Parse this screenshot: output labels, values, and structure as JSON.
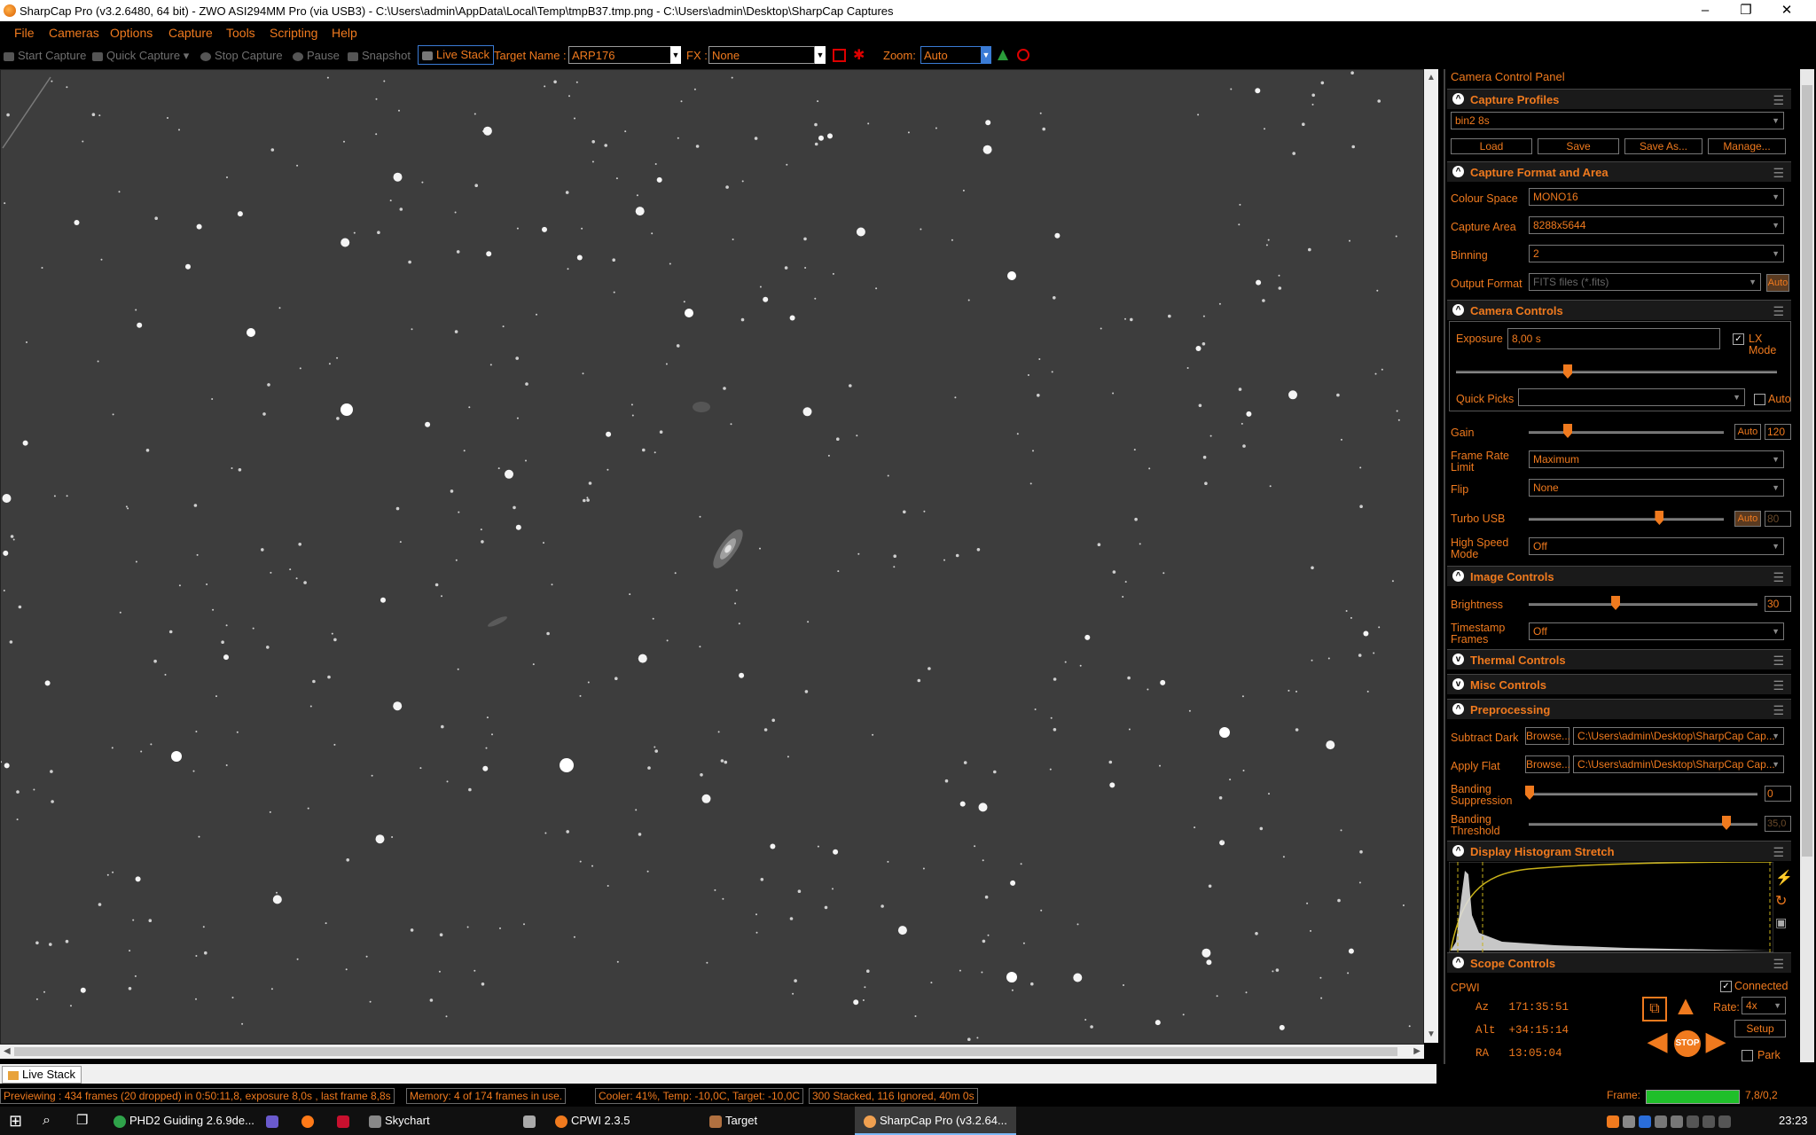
{
  "window": {
    "title": "SharpCap Pro (v3.2.6480, 64 bit) - ZWO ASI294MM Pro (via USB3) - C:\\Users\\admin\\AppData\\Local\\Temp\\tmpB37.tmp.png - C:\\Users\\admin\\Desktop\\SharpCap Captures",
    "minimize": "–",
    "restore": "❐",
    "close": "✕"
  },
  "menu": [
    "File",
    "Cameras",
    "Options",
    "Capture",
    "Tools",
    "Scripting",
    "Help"
  ],
  "toolbar": {
    "start_capture": "Start Capture",
    "quick_capture": "Quick Capture",
    "stop_capture": "Stop Capture",
    "pause": "Pause",
    "snapshot": "Snapshot",
    "live_stack": "Live Stack",
    "target_name_label": "Target Name :",
    "target_name_value": "ARP176",
    "fx_label": "FX :",
    "fx_value": "None",
    "zoom_label": "Zoom:",
    "zoom_value": "Auto"
  },
  "panel": {
    "title": "Camera Control Panel",
    "capture_profiles": {
      "header": "Capture Profiles",
      "profile": "bin2 8s",
      "load": "Load",
      "save": "Save",
      "save_as": "Save As...",
      "manage": "Manage..."
    },
    "format": {
      "header": "Capture Format and Area",
      "colour_space_label": "Colour Space",
      "colour_space": "MONO16",
      "capture_area_label": "Capture Area",
      "capture_area": "8288x5644",
      "binning_label": "Binning",
      "binning": "2",
      "output_format_label": "Output Format",
      "output_format": "FITS files (*.fits)",
      "auto": "Auto"
    },
    "camera_controls": {
      "header": "Camera Controls",
      "exposure_label": "Exposure",
      "exposure": "8,00 s",
      "lx_mode": "LX Mode",
      "quick_picks_label": "Quick Picks",
      "auto": "Auto",
      "gain_label": "Gain",
      "gain_auto": "Auto",
      "gain": "120",
      "gain_level": 0.2,
      "frame_rate_label": "Frame Rate Limit",
      "frame_rate": "Maximum",
      "flip_label": "Flip",
      "flip": "None",
      "turbo_usb_label": "Turbo USB",
      "turbo_auto": "Auto",
      "turbo_usb": "80",
      "turbo_level": 0.67,
      "high_speed_label": "High Speed Mode",
      "high_speed": "Off"
    },
    "image_controls": {
      "header": "Image Controls",
      "brightness_label": "Brightness",
      "brightness": "30",
      "brightness_level": 0.38,
      "timestamp_label": "Timestamp Frames",
      "timestamp": "Off"
    },
    "thermal": "Thermal Controls",
    "misc": "Misc Controls",
    "preprocessing": {
      "header": "Preprocessing",
      "subtract_dark_label": "Subtract Dark",
      "browse": "Browse...",
      "dark_path": "C:\\Users\\admin\\Desktop\\SharpCap Cap...",
      "apply_flat_label": "Apply Flat",
      "flat_path": "C:\\Users\\admin\\Desktop\\SharpCap Cap...",
      "banding_supp_label": "Banding Suppression",
      "banding_supp": "0",
      "banding_thresh_label": "Banding Threshold",
      "banding_thresh": "35,0"
    },
    "histogram": {
      "header": "Display Histogram Stretch"
    },
    "scope": {
      "header": "Scope Controls",
      "mount": "CPWI",
      "connected": "Connected",
      "az": "Az   171:35:51",
      "alt": "Alt  +34:15:14",
      "ra": "RA   13:05:04",
      "rate_label": "Rate:",
      "rate": "4x",
      "setup": "Setup",
      "stop": "STOP",
      "park": "Park"
    }
  },
  "tab": "Live Stack",
  "status": {
    "preview": "Previewing : 434 frames (20 dropped) in 0:50:11,8, exposure 8,0s , last frame 8,8s",
    "memory": "Memory: 4 of 174 frames in use.",
    "cooler": "Cooler: 41%, Temp: -10,0C, Target: -10,0C",
    "stacked": "300 Stacked, 116 Ignored, 40m 0s",
    "frame_label": "Frame:",
    "frame_value": "7,8/0,2"
  },
  "taskbar": {
    "phd2": "PHD2 Guiding 2.6.9de...",
    "skychart": "Skychart",
    "cpwi": "CPWI 2.3.5",
    "target": "Target",
    "sharpcap": "SharpCap Pro (v3.2.64...",
    "clock": "23:23"
  },
  "colors": {
    "accent": "#f07a1e",
    "background": "#000000",
    "sky": "#3c3c3c"
  }
}
